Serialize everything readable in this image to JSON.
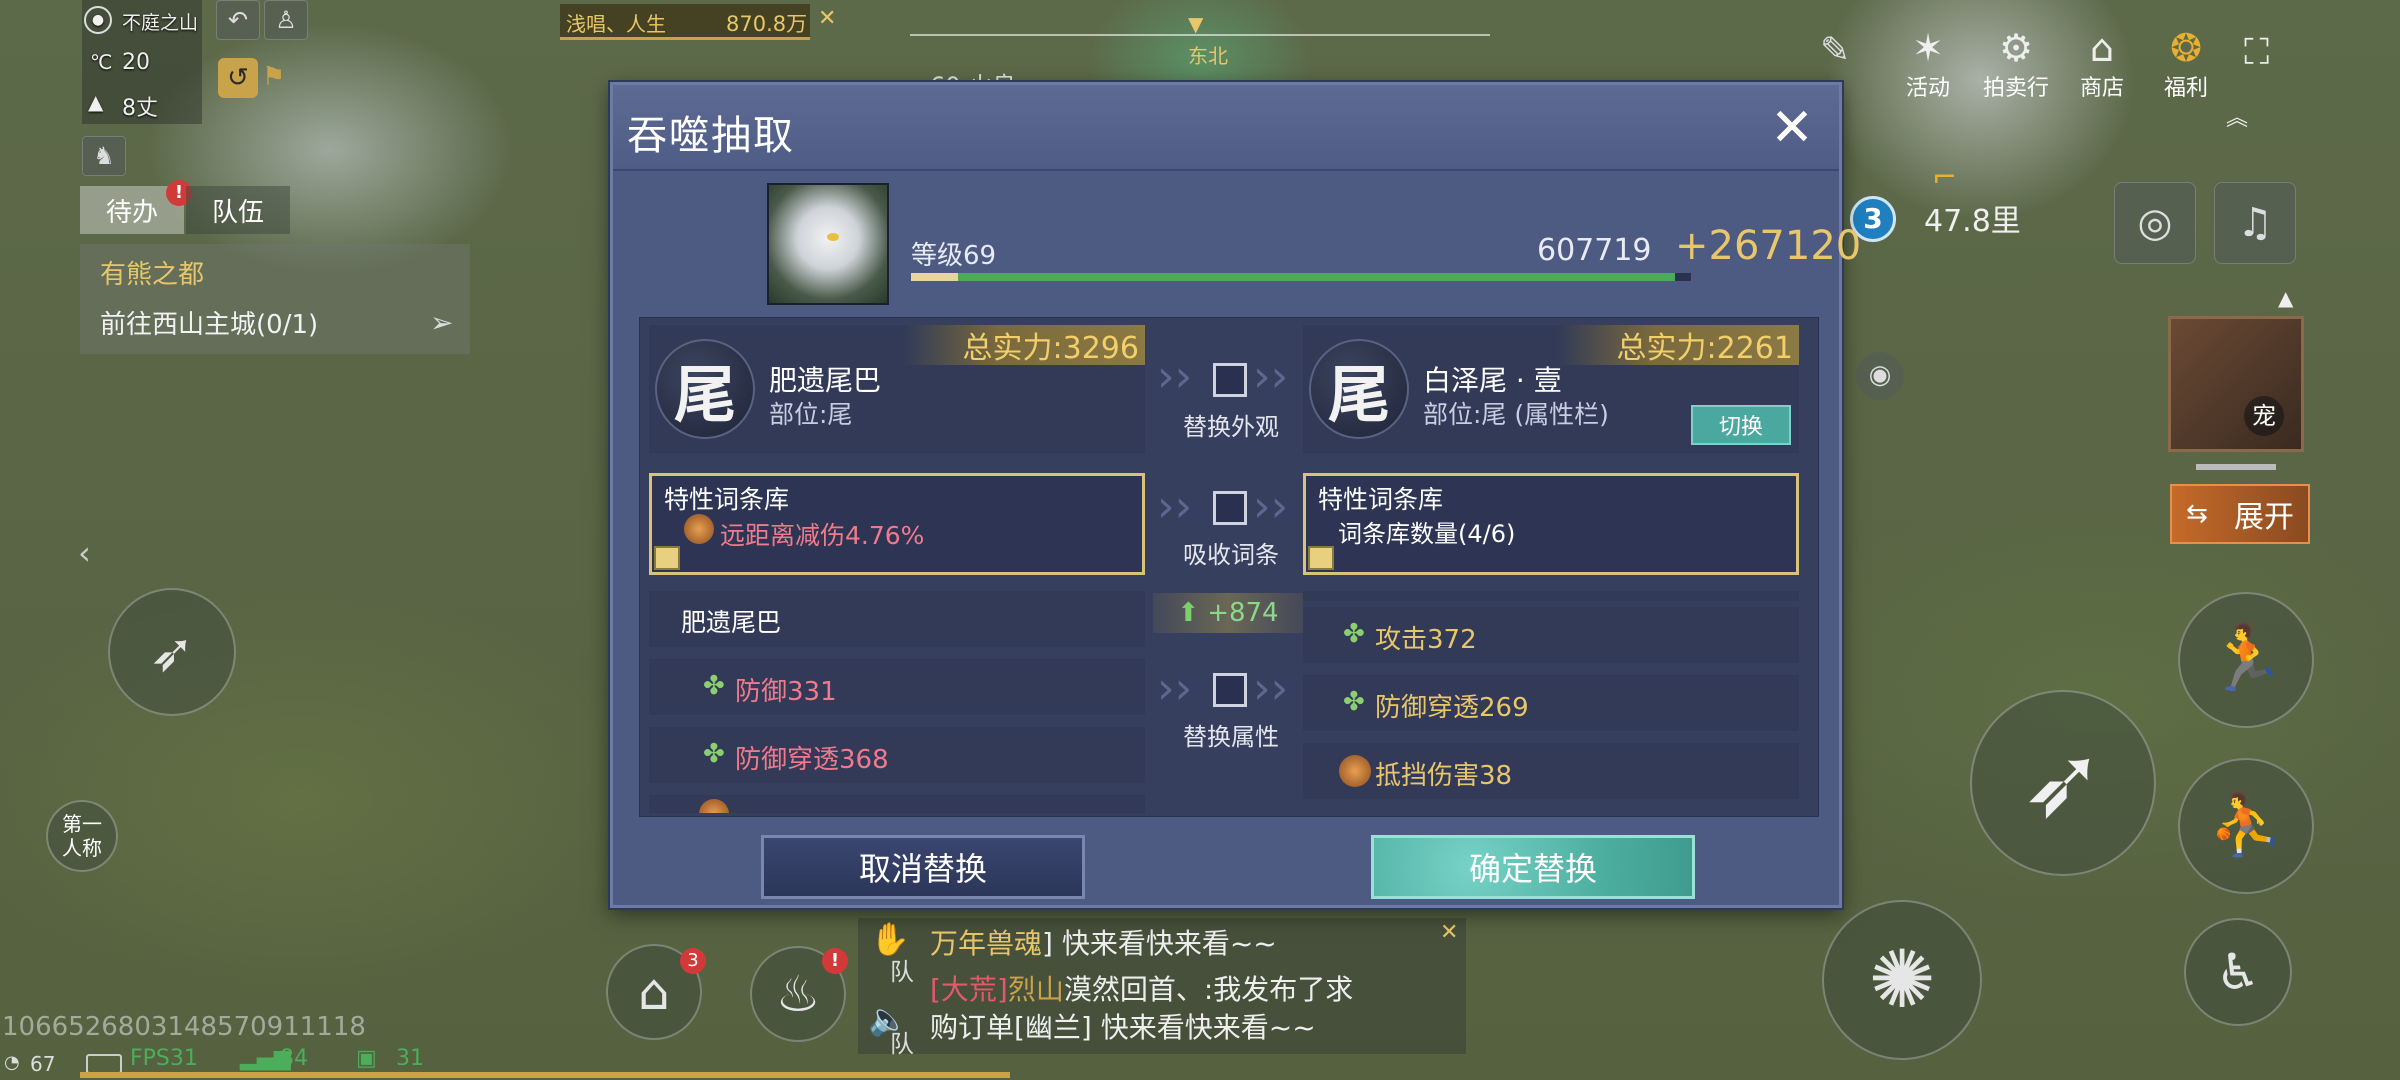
{
  "hud": {
    "location": "不庭之山",
    "temperature": "20",
    "height": "8丈",
    "top_chat_name": "浅唱、人生",
    "top_chat_value": "870.8万",
    "compass_dir": "东北",
    "partial_label": "60 火良",
    "tabs": [
      {
        "label": "待办"
      },
      {
        "label": "队伍"
      }
    ],
    "quest_title": "有熊之都",
    "quest_desc": "前往西山主城(0/1)",
    "distance": "47.8里",
    "distance_badge": "3",
    "right_menu": [
      {
        "label": "活动"
      },
      {
        "label": "拍卖行"
      },
      {
        "label": "商店"
      },
      {
        "label": "福利"
      }
    ],
    "expand_label": "展开",
    "pet_label": "宠",
    "view_label_1": "第一",
    "view_label_2": "人称",
    "home_badge": "3",
    "bag_badge": "!",
    "uid": "1066526803148570911118",
    "fps": "FPS31",
    "ping": "84",
    "battery": "31",
    "signal": "67"
  },
  "chat": {
    "line1_name": "万年兽魂",
    "line1_text": "] 快来看快来看~~",
    "line2_tag": "[大荒]",
    "line2_name": "烈山",
    "line2_text": "漠然回首、:我发布了求",
    "line3_text": "购订单[幽兰] 快来看快来看~~",
    "team": "队",
    "team2": "队"
  },
  "dialog": {
    "title": "吞噬抽取",
    "level": "等级69",
    "exp": "607719",
    "exp_gain": "+267120",
    "exp_fraction": 0.06,
    "exp_fill": 0.98,
    "left_item": {
      "name": "肥遗尾巴",
      "slot": "部位:尾",
      "power": "总实力:3296",
      "glyph": "尾"
    },
    "right_item": {
      "name": "白泽尾 · 壹",
      "slot": "部位:尾 (属性栏)",
      "power": "总实力:2261",
      "glyph": "尾",
      "switch_label": "切换"
    },
    "replace_appearance": "替换外观",
    "absorb_entry": "吸收词条",
    "replace_attr": "替换属性",
    "left_lib_title": "特性词条库",
    "left_lib_entry": "远距离减伤4.76%",
    "right_lib_title": "特性词条库",
    "right_lib_entry": "词条库数量(4/6)",
    "attr_gain": "+874",
    "left_attr_title": "肥遗尾巴",
    "left_attrs": [
      "防御331",
      "防御穿透368"
    ],
    "right_attrs": [
      "攻击372",
      "防御穿透269",
      "抵挡伤害38"
    ],
    "cancel_label": "取消替换",
    "confirm_label": "确定替换"
  },
  "colors": {
    "gold": "#e8c66a",
    "pink": "#f07a8c",
    "confirm": "#5bb9ad",
    "dialog": "#4d5a82"
  }
}
